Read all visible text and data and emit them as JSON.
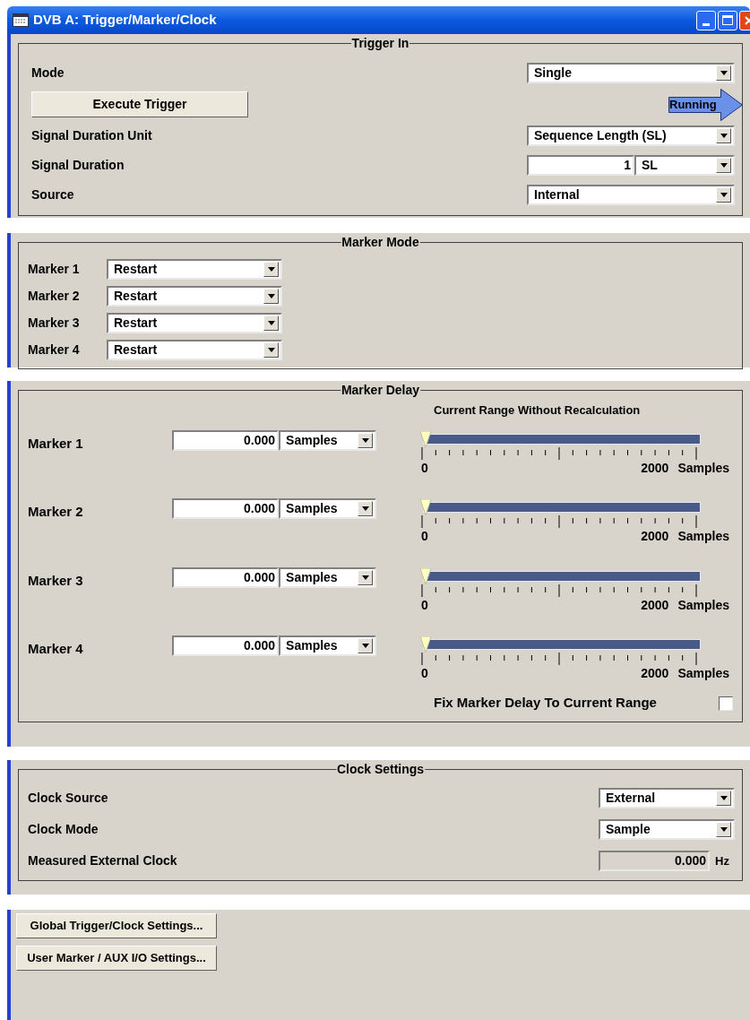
{
  "window": {
    "title": "DVB A: Trigger/Marker/Clock"
  },
  "trigger_in": {
    "title": "Trigger In",
    "rows": [
      {
        "kind": "dropdown",
        "label": "Mode",
        "value": "Single"
      },
      {
        "kind": "action",
        "button": "Execute Trigger",
        "status": "Running"
      },
      {
        "kind": "dropdown",
        "label": "Signal Duration Unit",
        "value": "Sequence Length (SL)"
      },
      {
        "kind": "number_unit",
        "label": "Signal Duration",
        "value": "1",
        "unit": "SL"
      },
      {
        "kind": "dropdown",
        "label": "Source",
        "value": "Internal"
      }
    ]
  },
  "marker_mode": {
    "title": "Marker Mode",
    "rows": [
      {
        "label": "Marker 1",
        "value": "Restart"
      },
      {
        "label": "Marker 2",
        "value": "Restart"
      },
      {
        "label": "Marker 3",
        "value": "Restart"
      },
      {
        "label": "Marker 4",
        "value": "Restart"
      }
    ]
  },
  "marker_delay": {
    "title": "Marker Delay",
    "range_title": "Current Range Without Recalculation",
    "markers": [
      {
        "label": "Marker 1",
        "value": "0.000",
        "unit": "Samples",
        "level": 0,
        "min": "0",
        "max": "2000",
        "max_unit": "Samples"
      },
      {
        "label": "Marker 2",
        "value": "0.000",
        "unit": "Samples",
        "level": 0,
        "min": "0",
        "max": "2000",
        "max_unit": "Samples"
      },
      {
        "label": "Marker 3",
        "value": "0.000",
        "unit": "Samples",
        "level": 0,
        "min": "0",
        "max": "2000",
        "max_unit": "Samples"
      },
      {
        "label": "Marker 4",
        "value": "0.000",
        "unit": "Samples",
        "level": 0,
        "min": "0",
        "max": "2000",
        "max_unit": "Samples"
      }
    ],
    "fix": {
      "label": "Fix Marker Delay To Current Range",
      "checked": false
    }
  },
  "clock_settings": {
    "title": "Clock Settings",
    "rows": [
      {
        "kind": "dropdown",
        "label": "Clock Source",
        "value": "External"
      },
      {
        "kind": "dropdown",
        "label": "Clock Mode",
        "value": "Sample"
      },
      {
        "kind": "readout",
        "label": "Measured External Clock",
        "value": "0.000",
        "unit": "Hz"
      }
    ]
  },
  "buttons": [
    "Global Trigger/Clock Settings...",
    "User Marker / AUX I/O Settings..."
  ]
}
